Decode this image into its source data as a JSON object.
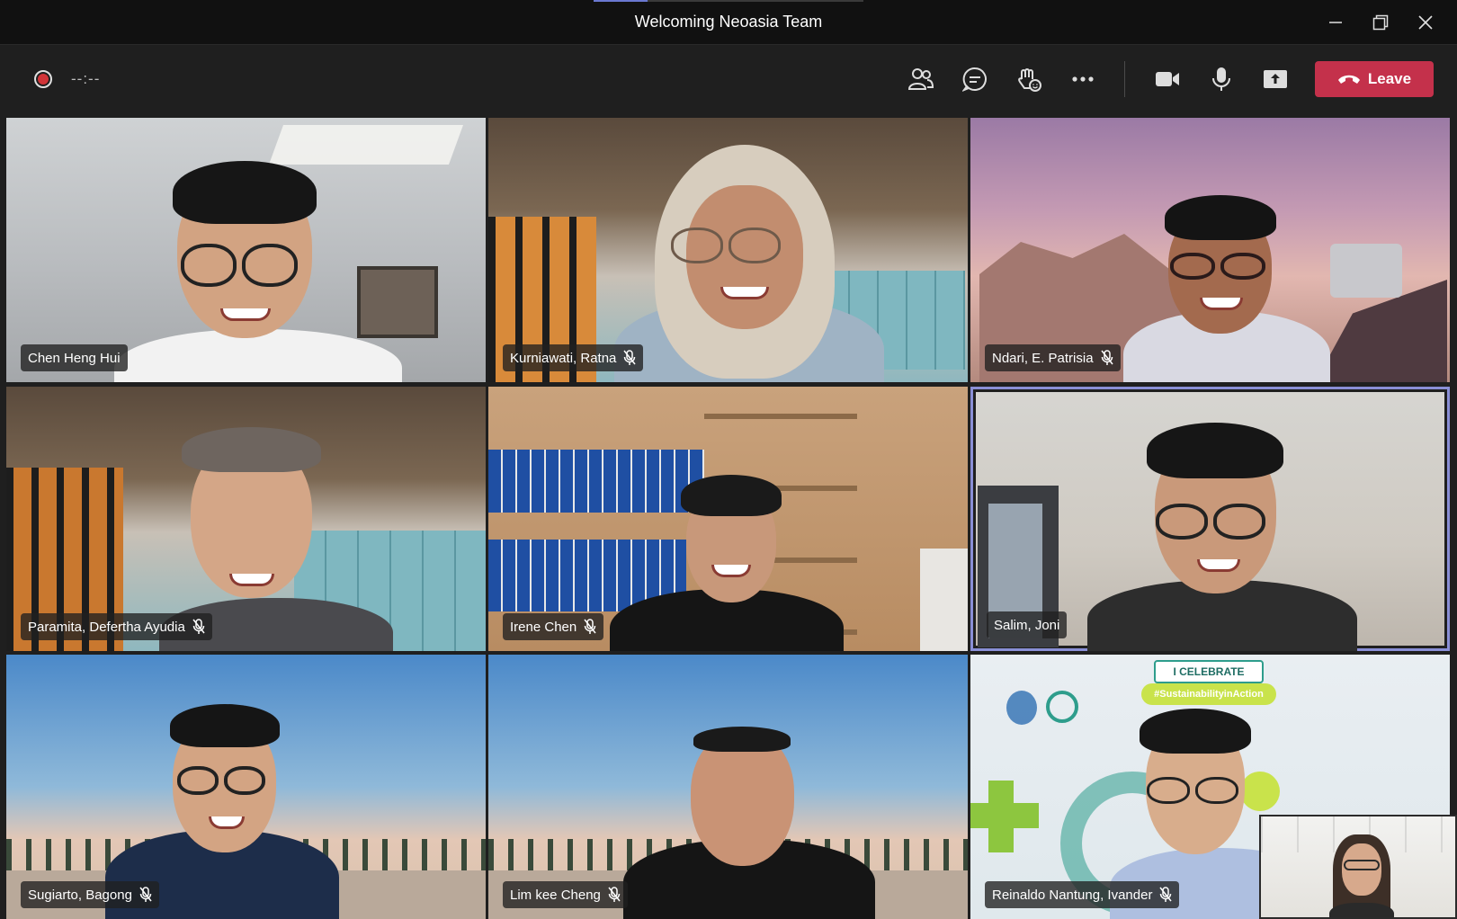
{
  "window": {
    "title": "Welcoming Neoasia Team",
    "controls": [
      "minimize-icon",
      "restore-icon",
      "close-icon"
    ]
  },
  "toolbar": {
    "timer": "--:--",
    "tools": [
      "people-icon",
      "chat-icon",
      "reactions-icon",
      "more-icon",
      "camera-icon",
      "mic-icon",
      "share-screen-icon"
    ],
    "leave_label": "Leave",
    "leave_color": "#c4314b"
  },
  "participants": [
    {
      "name": "Chen Heng Hui",
      "muted": false
    },
    {
      "name": "Kurniawati, Ratna",
      "muted": true
    },
    {
      "name": "Ndari, E. Patrisia",
      "muted": true
    },
    {
      "name": "Paramita, Defertha Ayudia",
      "muted": true
    },
    {
      "name": "Irene Chen",
      "muted": true
    },
    {
      "name": "Salim, Joni",
      "muted": false,
      "active_speaker": true
    },
    {
      "name": "Sugiarto, Bagong",
      "muted": true
    },
    {
      "name": "Lim kee Cheng",
      "muted": true
    },
    {
      "name": "Reinaldo Nantung, Ivander",
      "muted": true
    }
  ],
  "background_banner": {
    "line1": "I CELEBRATE",
    "line2": "#SustainabilityinAction"
  },
  "colors": {
    "active_speaker_border": "#8a8fd6",
    "recording_dot": "#d13438"
  }
}
